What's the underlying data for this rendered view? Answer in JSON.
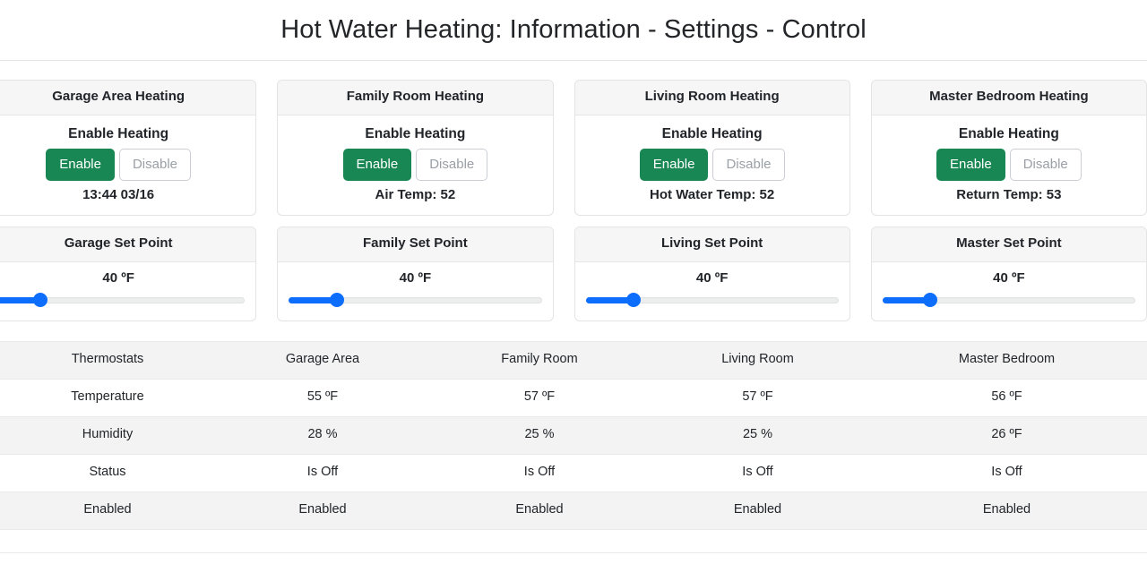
{
  "header": {
    "title": "Hot Water Heating: Information - Settings - Control"
  },
  "colors": {
    "enable_green": "#198754",
    "slider_blue": "#0d6efd",
    "card_header_bg": "#f6f6f7",
    "row_shaded_bg": "#f3f3f4"
  },
  "heating_cards": [
    {
      "title": "Garage Area Heating",
      "enable_label": "Enable Heating",
      "enable_button": "Enable",
      "disable_button": "Disable",
      "status": "13:44 03/16"
    },
    {
      "title": "Family Room Heating",
      "enable_label": "Enable Heating",
      "enable_button": "Enable",
      "disable_button": "Disable",
      "status": "Air Temp: 52"
    },
    {
      "title": "Living Room Heating",
      "enable_label": "Enable Heating",
      "enable_button": "Enable",
      "disable_button": "Disable",
      "status": "Hot Water Temp: 52"
    },
    {
      "title": "Master Bedroom Heating",
      "enable_label": "Enable Heating",
      "enable_button": "Enable",
      "disable_button": "Disable",
      "status": "Return Temp: 53"
    }
  ],
  "setpoint_cards": [
    {
      "title": "Garage Set Point",
      "value": "40 ºF",
      "percent": 19
    },
    {
      "title": "Family Set Point",
      "value": "40 ºF",
      "percent": 19
    },
    {
      "title": "Living Set Point",
      "value": "40 ºF",
      "percent": 19
    },
    {
      "title": "Master Set Point",
      "value": "40 ºF",
      "percent": 19
    }
  ],
  "table": {
    "headers": [
      "Thermostats",
      "Garage Area",
      "Family Room",
      "Living Room",
      "Master Bedroom"
    ],
    "rows": [
      {
        "label": "Temperature",
        "values": [
          "55 ºF",
          "57 ºF",
          "57 ºF",
          "56 ºF"
        ]
      },
      {
        "label": "Humidity",
        "values": [
          "28 %",
          "25 %",
          "25 %",
          "26 ºF"
        ]
      },
      {
        "label": "Status",
        "values": [
          "Is Off",
          "Is Off",
          "Is Off",
          "Is Off"
        ]
      },
      {
        "label": "Enabled",
        "values": [
          "Enabled",
          "Enabled",
          "Enabled",
          "Enabled"
        ]
      }
    ]
  }
}
